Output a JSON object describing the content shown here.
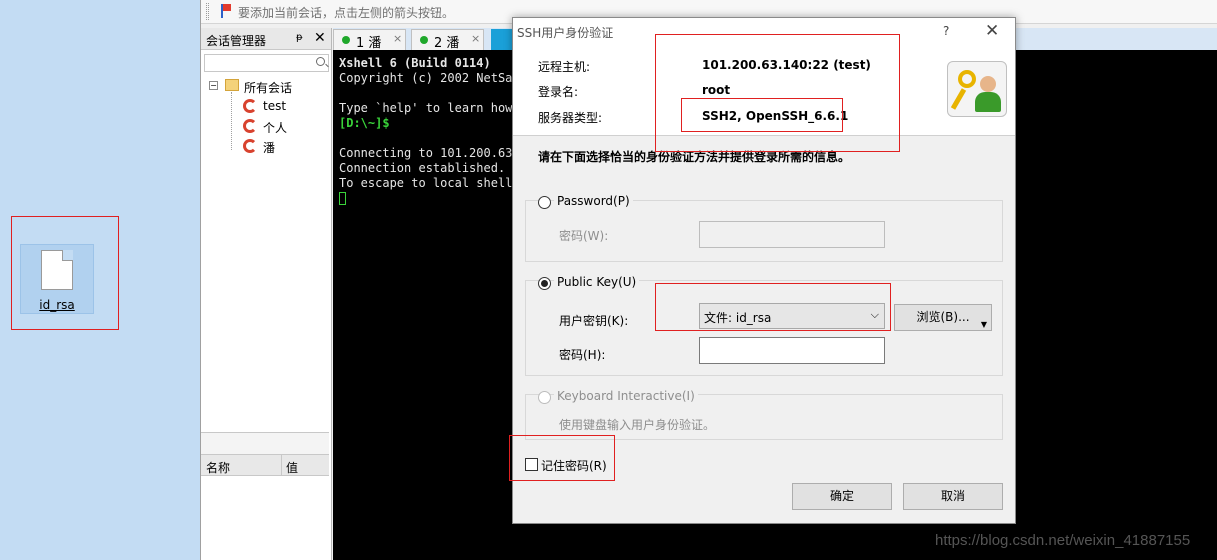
{
  "desktop": {
    "file_label": "id_rsa"
  },
  "hint_bar": {
    "text": "要添加当前会话，点击左侧的箭头按钮。"
  },
  "session_manager": {
    "title": "会话管理器",
    "pin": "ᵽ",
    "close": "✕",
    "tree_toggle": "−",
    "root": "所有会话",
    "items": [
      {
        "label": "test"
      },
      {
        "label": "个人"
      },
      {
        "label": "潘"
      }
    ],
    "props_name": "名称",
    "props_value": "值"
  },
  "tabs": [
    {
      "label": "1 潘",
      "close": "×"
    },
    {
      "label": "2 潘",
      "close": "×"
    }
  ],
  "terminal": {
    "lines": [
      "Xshell 6 (Build 0114)",
      "Copyright (c) 2002 NetSar",
      "",
      "Type `help' to learn how",
      "[D:\\~]$",
      "",
      "Connecting to 101.200.63.",
      "Connection established.",
      "To escape to local shell,"
    ]
  },
  "dialog": {
    "title": "SSH用户身份验证",
    "help": "?",
    "close": "✕",
    "remote_host_label": "远程主机:",
    "remote_host_value": "101.200.63.140:22 (test)",
    "login_label": "登录名:",
    "login_value": "root",
    "server_type_label": "服务器类型:",
    "server_type_value": "SSH2, OpenSSH_6.6.1",
    "instruction": "请在下面选择恰当的身份验证方法并提供登录所需的信息。",
    "password_option": "Password(P)",
    "password_label": "密码(W):",
    "publickey_option": "Public Key(U)",
    "user_key_label": "用户密钥(K):",
    "user_key_value": "文件: id_rsa",
    "browse_button": "浏览(B)...",
    "passphrase_label": "密码(H):",
    "keyboard_option": "Keyboard Interactive(I)",
    "keyboard_desc": "使用键盘输入用户身份验证。",
    "remember_label": "记住密码(R)",
    "ok_button": "确定",
    "cancel_button": "取消"
  },
  "watermark": "https://blog.csdn.net/weixin_41887155",
  "colors": {
    "terminal_bg": "#000000",
    "prompt": "#3ad33a",
    "tab_dot": "#1fa82b",
    "annotation": "#e02020"
  }
}
